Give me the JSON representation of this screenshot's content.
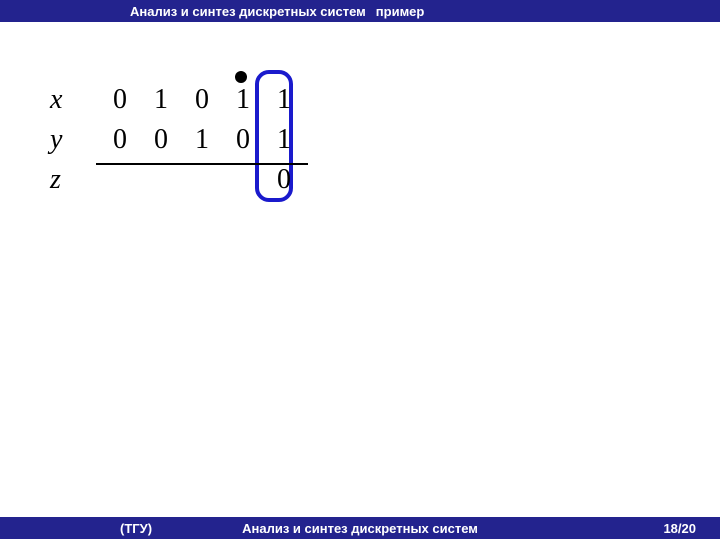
{
  "header": {
    "topic": "Анализ и синтез дискретных систем",
    "tag": "пример"
  },
  "footer": {
    "org": "(ТГУ)",
    "title": "Анализ и синтез дискретных систем",
    "page": "18/20"
  },
  "table": {
    "rows": [
      {
        "label": "x",
        "cells": [
          "0",
          "1",
          "0",
          "1",
          "1"
        ]
      },
      {
        "label": "y",
        "cells": [
          "0",
          "0",
          "1",
          "0",
          "1"
        ]
      },
      {
        "label": "z",
        "cells": [
          "",
          "",
          "",
          "",
          "0"
        ]
      }
    ]
  },
  "chart_data": {
    "type": "table",
    "title": "Truth table fragment",
    "columns": [
      "x",
      "y",
      "z"
    ],
    "rows": [
      {
        "x": 0,
        "y": 0,
        "z": null
      },
      {
        "x": 1,
        "y": 0,
        "z": null
      },
      {
        "x": 0,
        "y": 1,
        "z": null
      },
      {
        "x": 1,
        "y": 0,
        "z": null
      },
      {
        "x": 1,
        "y": 1,
        "z": 0
      }
    ],
    "highlight_column_index": 4,
    "marker_column_index": 3
  }
}
